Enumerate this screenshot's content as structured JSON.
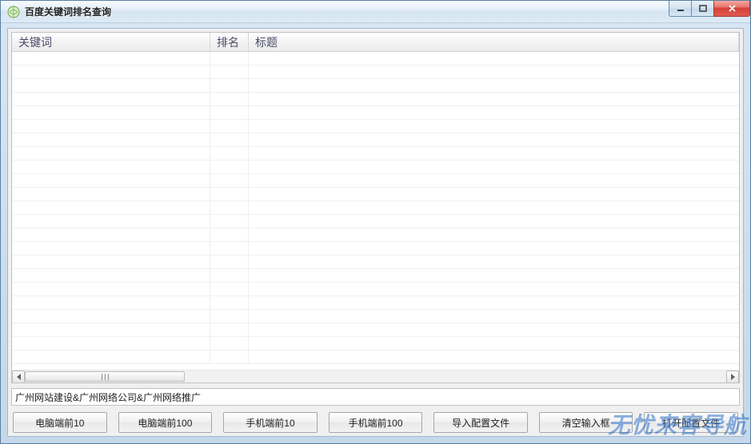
{
  "window": {
    "title": "百度关键词排名查询"
  },
  "table": {
    "columns": {
      "keyword": "关键词",
      "rank": "排名",
      "title": "标题"
    },
    "rows": []
  },
  "input": {
    "value": "广州网站建设&广州网络公司&广州网络推广"
  },
  "buttons": {
    "pc10": "电脑端前10",
    "pc100": "电脑端前100",
    "mobile10": "手机端前10",
    "mobile100": "手机端前100",
    "import": "导入配置文件",
    "clear": "清空输入框",
    "open": "打开配置文件"
  },
  "watermark": "无忧来客导航"
}
